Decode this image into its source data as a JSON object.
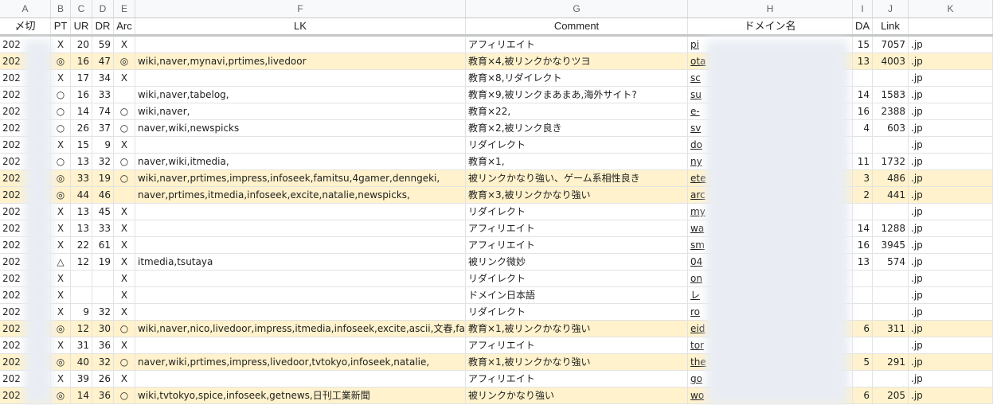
{
  "columns": [
    "A",
    "B",
    "C",
    "D",
    "E",
    "F",
    "G",
    "H",
    "I",
    "J",
    "K"
  ],
  "headers": [
    "〆切",
    "PT",
    "UR",
    "DR",
    "Arc",
    "LK",
    "Comment",
    "ドメイン名",
    "DA",
    "Link",
    ""
  ],
  "rows": [
    {
      "a": "202",
      "pt": "X",
      "ur": "20",
      "dr": "59",
      "arc": "X",
      "lk": "",
      "comment": "アフィリエイト",
      "domain": "pi",
      "da": "15",
      "link": "7057",
      "tld": ".jp",
      "hl": false
    },
    {
      "a": "202",
      "pt": "◎",
      "ur": "16",
      "dr": "47",
      "arc": "◎",
      "lk": "wiki,naver,mynavi,prtimes,livedoor",
      "comment": "教育×4,被リンクかなりツヨ",
      "domain": "ota",
      "da": "13",
      "link": "4003",
      "tld": ".jp",
      "hl": true
    },
    {
      "a": "202",
      "pt": "X",
      "ur": "17",
      "dr": "34",
      "arc": "X",
      "lk": "",
      "comment": "教育×8,リダイレクト",
      "domain": "sc",
      "da": "",
      "link": "",
      "tld": ".jp",
      "hl": false
    },
    {
      "a": "202",
      "pt": "○",
      "ur": "16",
      "dr": "33",
      "arc": "",
      "lk": "wiki,naver,tabelog,",
      "comment": "教育×9,被リンクまあまあ,海外サイト?",
      "domain": "su",
      "da": "14",
      "link": "1583",
      "tld": ".jp",
      "hl": false
    },
    {
      "a": "202",
      "pt": "○",
      "ur": "14",
      "dr": "74",
      "arc": "○",
      "lk": "wiki,naver,",
      "comment": "教育×22,",
      "domain": "e-",
      "da": "16",
      "link": "2388",
      "tld": ".jp",
      "hl": false
    },
    {
      "a": "202",
      "pt": "○",
      "ur": "26",
      "dr": "37",
      "arc": "○",
      "lk": "naver,wiki,newspicks",
      "comment": "教育×2,被リンク良き",
      "domain": "sv",
      "da": "4",
      "link": "603",
      "tld": ".jp",
      "hl": false
    },
    {
      "a": "202",
      "pt": "X",
      "ur": "15",
      "dr": "9",
      "arc": "X",
      "lk": "",
      "comment": "リダイレクト",
      "domain": "do",
      "da": "",
      "link": "",
      "tld": ".jp",
      "hl": false
    },
    {
      "a": "202",
      "pt": "○",
      "ur": "13",
      "dr": "32",
      "arc": "○",
      "lk": "naver,wiki,itmedia,",
      "comment": "教育×1,",
      "domain": "ny",
      "da": "11",
      "link": "1732",
      "tld": ".jp",
      "hl": false
    },
    {
      "a": "202",
      "pt": "◎",
      "ur": "33",
      "dr": "19",
      "arc": "○",
      "lk": "wiki,naver,prtimes,impress,infoseek,famitsu,4gamer,denngeki,",
      "comment": "被リンクかなり強い、ゲーム系相性良き",
      "domain": "ete",
      "da": "3",
      "link": "486",
      "tld": ".jp",
      "hl": true
    },
    {
      "a": "202",
      "pt": "◎",
      "ur": "44",
      "dr": "46",
      "arc": "",
      "lk": "naver,prtimes,itmedia,infoseek,excite,natalie,newspicks,",
      "comment": "教育×3,被リンクかなり強い",
      "domain": "arc",
      "da": "2",
      "link": "441",
      "tld": ".jp",
      "hl": true
    },
    {
      "a": "202",
      "pt": "X",
      "ur": "13",
      "dr": "45",
      "arc": "X",
      "lk": "",
      "comment": "リダイレクト",
      "domain": "my",
      "da": "",
      "link": "",
      "tld": ".jp",
      "hl": false
    },
    {
      "a": "202",
      "pt": "X",
      "ur": "13",
      "dr": "33",
      "arc": "X",
      "lk": "",
      "comment": "アフィリエイト",
      "domain": "wa",
      "da": "14",
      "link": "1288",
      "tld": ".jp",
      "hl": false
    },
    {
      "a": "202",
      "pt": "X",
      "ur": "22",
      "dr": "61",
      "arc": "X",
      "lk": "",
      "comment": "アフィリエイト",
      "domain": "sm",
      "da": "16",
      "link": "3945",
      "tld": ".jp",
      "hl": false
    },
    {
      "a": "202",
      "pt": "△",
      "ur": "12",
      "dr": "19",
      "arc": "X",
      "lk": "itmedia,tsutaya",
      "comment": "被リンク微妙",
      "domain": "04",
      "da": "13",
      "link": "574",
      "tld": ".jp",
      "hl": false
    },
    {
      "a": "202",
      "pt": "X",
      "ur": "",
      "dr": "",
      "arc": "X",
      "lk": "",
      "comment": "リダイレクト",
      "domain": "on",
      "da": "",
      "link": "",
      "tld": ".jp",
      "hl": false
    },
    {
      "a": "202",
      "pt": "X",
      "ur": "",
      "dr": "",
      "arc": "X",
      "lk": "",
      "comment": "ドメイン日本語",
      "domain": "レ",
      "da": "",
      "link": "",
      "tld": ".jp",
      "hl": false
    },
    {
      "a": "202",
      "pt": "X",
      "ur": "9",
      "dr": "32",
      "arc": "X",
      "lk": "",
      "comment": "リダイレクト",
      "domain": "ro",
      "da": "",
      "link": "",
      "tld": ".jp",
      "hl": false
    },
    {
      "a": "202",
      "pt": "◎",
      "ur": "12",
      "dr": "30",
      "arc": "○",
      "lk": "wiki,naver,nico,livedoor,impress,itmedia,infoseek,excite,ascii,文春,fam",
      "comment": "教育×1,被リンクかなり強い",
      "domain": "eid",
      "da": "6",
      "link": "311",
      "tld": ".jp",
      "hl": true
    },
    {
      "a": "202",
      "pt": "X",
      "ur": "31",
      "dr": "36",
      "arc": "X",
      "lk": "",
      "comment": "アフィリエイト",
      "domain": "tor",
      "da": "",
      "link": "",
      "tld": ".jp",
      "hl": false
    },
    {
      "a": "202",
      "pt": "◎",
      "ur": "40",
      "dr": "32",
      "arc": "○",
      "lk": "naver,wiki,prtimes,impress,livedoor,tvtokyo,infoseek,natalie,",
      "comment": "教育×1,被リンクかなり強い",
      "domain": "the",
      "da": "5",
      "link": "291",
      "tld": ".jp",
      "hl": true
    },
    {
      "a": "202",
      "pt": "X",
      "ur": "39",
      "dr": "26",
      "arc": "X",
      "lk": "",
      "comment": "アフィリエイト",
      "domain": "go",
      "da": "",
      "link": "",
      "tld": ".jp",
      "hl": false
    },
    {
      "a": "202",
      "pt": "◎",
      "ur": "14",
      "dr": "36",
      "arc": "○",
      "lk": "wiki,tvtokyo,spice,infoseek,getnews,日刊工業新聞",
      "comment": "被リンクかなり強い",
      "domain": "wo",
      "da": "6",
      "link": "205",
      "tld": ".jp",
      "hl": true
    }
  ]
}
